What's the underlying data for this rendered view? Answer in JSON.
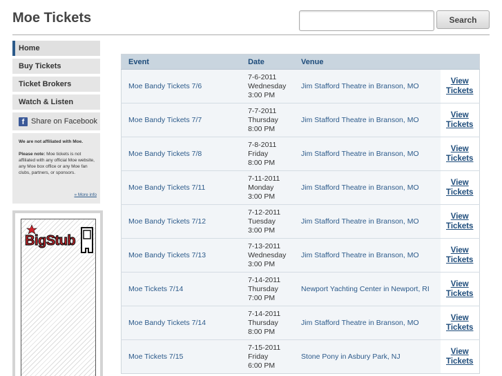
{
  "header": {
    "title": "Moe Tickets",
    "search": {
      "value": "",
      "placeholder": ""
    },
    "search_button": "Search"
  },
  "sidebar": {
    "items": [
      {
        "label": "Home",
        "active": true
      },
      {
        "label": "Buy Tickets"
      },
      {
        "label": "Ticket Brokers"
      },
      {
        "label": "Watch & Listen"
      }
    ],
    "facebook": {
      "icon": "facebook-icon",
      "label": "Share on Facebook"
    },
    "disclaimer": {
      "heading": "We are not affiliated with Moe.",
      "note_bold": "Please note:",
      "note_text": " Moe tickets is not affiliated with any official Moe website, any Moe box office or any Moe fan clubs, partners, or sponsors.",
      "more": "» More info"
    },
    "ad": {
      "logo_text": "BigStub",
      "logo_icon": "ticket-stub-icon"
    }
  },
  "table": {
    "headers": [
      "Event",
      "Date",
      "Venue",
      ""
    ],
    "link_label": [
      "View",
      "Tickets"
    ],
    "rows": [
      {
        "event": "Moe Bandy Tickets 7/6",
        "date": "7-6-2011",
        "weekday": "Wednesday",
        "time": "3:00 PM",
        "venue": "Jim Stafford Theatre in Branson, MO"
      },
      {
        "event": "Moe Bandy Tickets 7/7",
        "date": "7-7-2011",
        "weekday": "Thursday",
        "time": "8:00 PM",
        "venue": "Jim Stafford Theatre in Branson, MO"
      },
      {
        "event": "Moe Bandy Tickets 7/8",
        "date": "7-8-2011",
        "weekday": "Friday",
        "time": "8:00 PM",
        "venue": "Jim Stafford Theatre in Branson, MO"
      },
      {
        "event": "Moe Bandy Tickets 7/11",
        "date": "7-11-2011",
        "weekday": "Monday",
        "time": "3:00 PM",
        "venue": "Jim Stafford Theatre in Branson, MO"
      },
      {
        "event": "Moe Bandy Tickets 7/12",
        "date": "7-12-2011",
        "weekday": "Tuesday",
        "time": "3:00 PM",
        "venue": "Jim Stafford Theatre in Branson, MO"
      },
      {
        "event": "Moe Bandy Tickets 7/13",
        "date": "7-13-2011",
        "weekday": "Wednesday",
        "time": "3:00 PM",
        "venue": "Jim Stafford Theatre in Branson, MO"
      },
      {
        "event": "Moe Tickets 7/14",
        "date": "7-14-2011",
        "weekday": "Thursday",
        "time": "7:00 PM",
        "venue": "Newport Yachting Center in Newport, RI"
      },
      {
        "event": "Moe Bandy Tickets 7/14",
        "date": "7-14-2011",
        "weekday": "Thursday",
        "time": "8:00 PM",
        "venue": "Jim Stafford Theatre in Branson, MO"
      },
      {
        "event": "Moe Tickets 7/15",
        "date": "7-15-2011",
        "weekday": "Friday",
        "time": "6:00 PM",
        "venue": "Stone Pony in Asbury Park, NJ"
      }
    ]
  },
  "colors": {
    "accent": "#2c5a8a",
    "table_header_bg": "#c9d5df",
    "row_bg": "#f2f5f8",
    "facebook": "#3b5998",
    "logo_red": "#d2232a"
  }
}
